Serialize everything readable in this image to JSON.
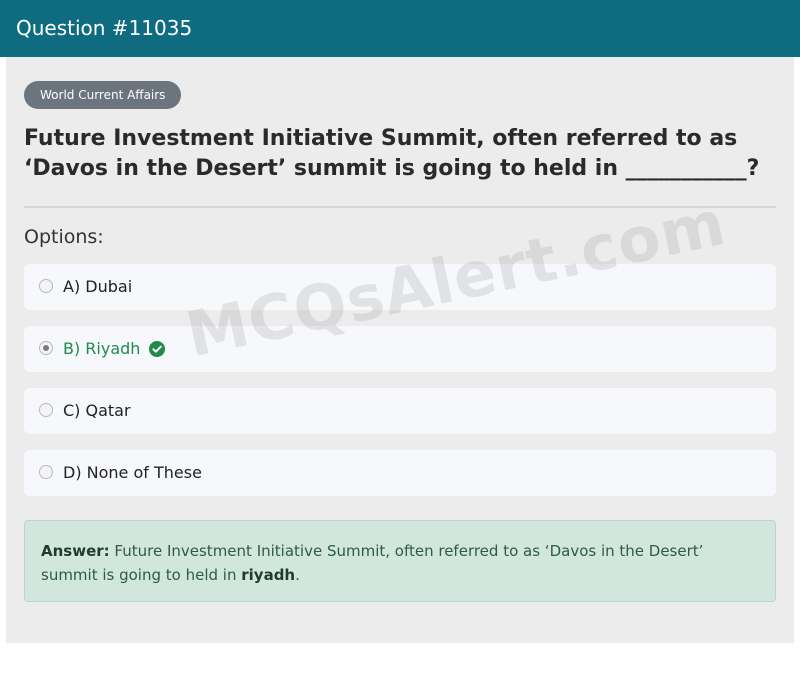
{
  "header": {
    "title": "Question #11035"
  },
  "category_badge": "World Current Affairs",
  "question": "Future Investment Initiative Summit, often referred to as ‘Davos in the Desert’ summit is going to held in ___________?",
  "options_label": "Options:",
  "options": [
    {
      "label": "A) Dubai",
      "selected": false
    },
    {
      "label": "B) Riyadh",
      "selected": true,
      "correct": true
    },
    {
      "label": "C) Qatar",
      "selected": false
    },
    {
      "label": "D) None of These",
      "selected": false
    }
  ],
  "answer": {
    "prefix": "Answer:",
    "text": " Future Investment Initiative Summit, often referred to as ‘Davos in the Desert’ summit is going to held in ",
    "highlight": "riyadh",
    "suffix": "."
  },
  "watermark": "MCQsAlert.com",
  "colors": {
    "header_bg": "#0e6b80",
    "correct_green": "#218a4c",
    "answer_bg": "#d1e7dd"
  }
}
